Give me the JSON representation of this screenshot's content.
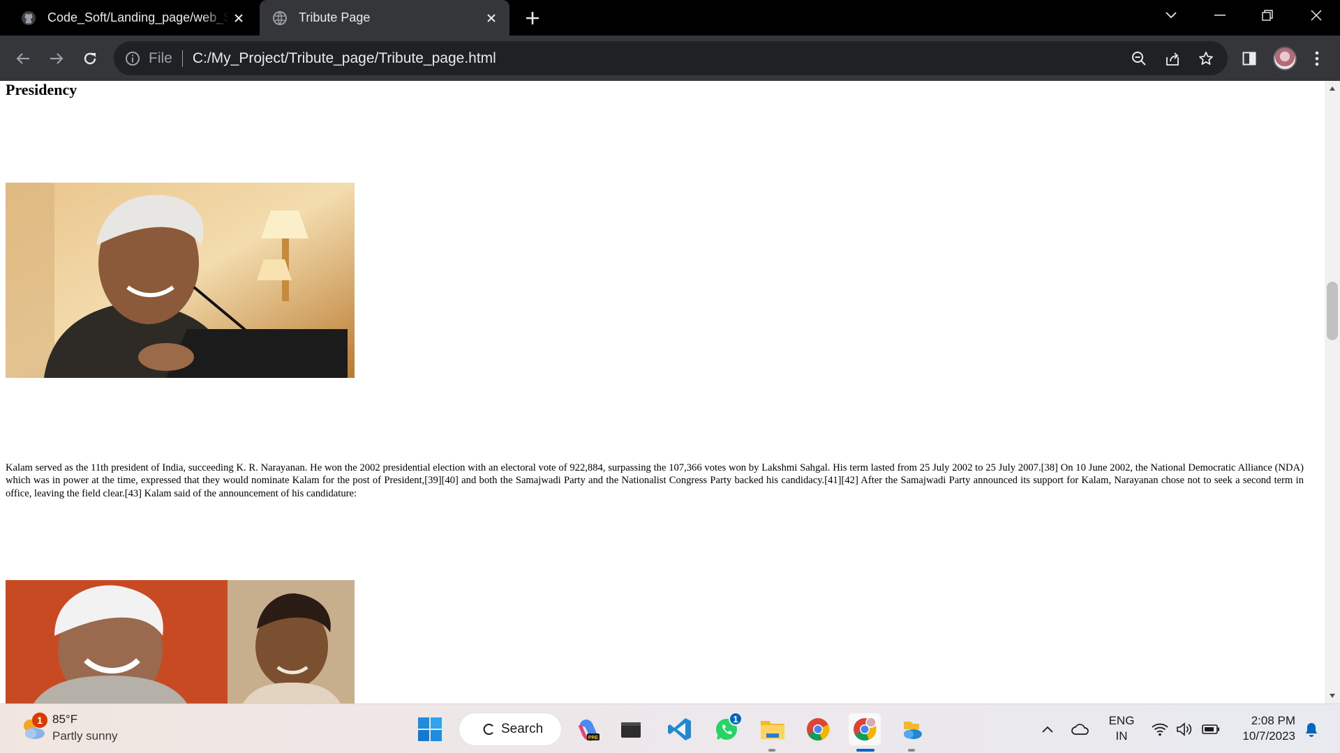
{
  "browser": {
    "tabs": [
      {
        "title": "Code_Soft/Landing_page/web_S",
        "favicon": "github-icon",
        "active": false
      },
      {
        "title": "Tribute Page",
        "favicon": "globe-icon",
        "active": true
      }
    ],
    "address": {
      "scheme_chip": "File",
      "url": "C:/My_Project/Tribute_page/Tribute_page.html"
    }
  },
  "page": {
    "section_heading": "Presidency",
    "paragraph": "Kalam served as the 11th president of India, succeeding K. R. Narayanan. He won the 2002 presidential election with an electoral vote of 922,884, surpassing the 107,366 votes won by Lakshmi Sahgal. His term lasted from 25 July 2002 to 25 July 2007.[38] On 10 June 2002, the National Democratic Alliance (NDA) which was in power at the time, expressed that they would nominate Kalam for the post of President,[39][40] and both the Samajwadi Party and the Nationalist Congress Party backed his candidacy.[41][42] After the Samajwadi Party announced its support for Kalam, Narayanan chose not to seek a second term in office, leaving the field clear.[43] Kalam said of the announcement of his candidature:",
    "images": [
      {
        "subject": "portrait-speaking-at-microphone"
      },
      {
        "subject": "portrait-side-by-side-childhood-photo"
      }
    ]
  },
  "taskbar": {
    "weather": {
      "temp": "85°F",
      "desc": "Partly sunny",
      "badge": "1"
    },
    "search_label": "Search",
    "whatsapp_badge": "1",
    "language": {
      "line1": "ENG",
      "line2": "IN"
    },
    "clock": {
      "time": "2:08 PM",
      "date": "10/7/2023"
    }
  },
  "colors": {
    "tabstrip": "#000000",
    "toolbar": "#35363a",
    "omnibox": "#202124",
    "page_bg": "#ffffff"
  }
}
